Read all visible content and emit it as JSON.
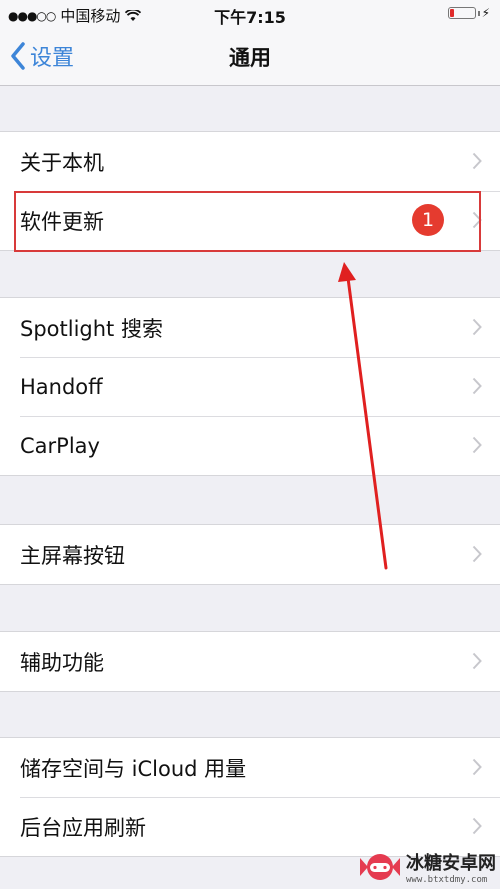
{
  "status_bar": {
    "signal": "●●●○○",
    "carrier": "中国移动",
    "time": "下午7:15"
  },
  "nav": {
    "back_label": "设置",
    "title": "通用"
  },
  "groups": [
    {
      "items": [
        {
          "label": "关于本机"
        },
        {
          "label": "软件更新",
          "badge": "1"
        }
      ]
    },
    {
      "items": [
        {
          "label": "Spotlight 搜索"
        },
        {
          "label": "Handoff"
        },
        {
          "label": "CarPlay"
        }
      ]
    },
    {
      "items": [
        {
          "label": "主屏幕按钮"
        }
      ]
    },
    {
      "items": [
        {
          "label": "辅助功能"
        }
      ]
    },
    {
      "items": [
        {
          "label": "储存空间与 iCloud 用量"
        },
        {
          "label": "后台应用刷新"
        }
      ]
    }
  ],
  "watermark": {
    "title": "冰糖安卓网",
    "url": "www.btxtdmy.com"
  },
  "colors": {
    "accent": "#3d85d8",
    "badge": "#e53b2f",
    "annotation": "#d83a3a",
    "battery_low": "#e02a2a"
  }
}
